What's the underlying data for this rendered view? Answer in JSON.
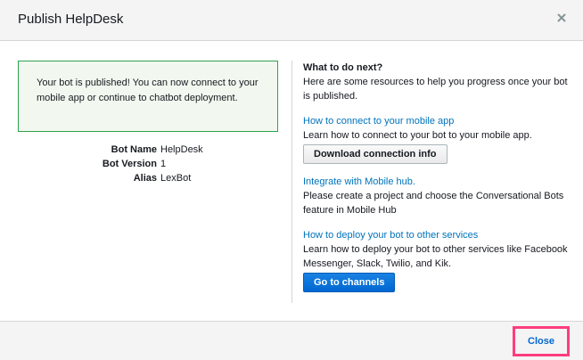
{
  "modal": {
    "title": "Publish HelpDesk",
    "close_icon": "close-icon"
  },
  "success_message": "Your bot is published! You can now connect to your mobile app or continue to chatbot deployment.",
  "details": [
    {
      "label": "Bot Name",
      "value": "HelpDesk"
    },
    {
      "label": "Bot Version",
      "value": "1"
    },
    {
      "label": "Alias",
      "value": "LexBot"
    }
  ],
  "next_steps": {
    "heading": "What to do next?",
    "intro": "Here are some resources to help you progress once your bot is published.",
    "sections": [
      {
        "link": "How to connect to your mobile app",
        "description": "Learn how to connect to your bot to your mobile app.",
        "button": "Download connection info"
      },
      {
        "link": "Integrate with Mobile hub.",
        "description": "Please create a project and choose the Conversational Bots feature in Mobile Hub"
      },
      {
        "link": "How to deploy your bot to other services",
        "description": "Learn how to deploy your bot to other services like Facebook Messenger, Slack, Twilio, and Kik.",
        "button": "Go to channels"
      }
    ]
  },
  "footer": {
    "close_label": "Close"
  },
  "colors": {
    "success_border": "#2fa14f",
    "link": "#0073bb",
    "primary_button": "#0067d1",
    "highlight": "#ff3d7f"
  }
}
